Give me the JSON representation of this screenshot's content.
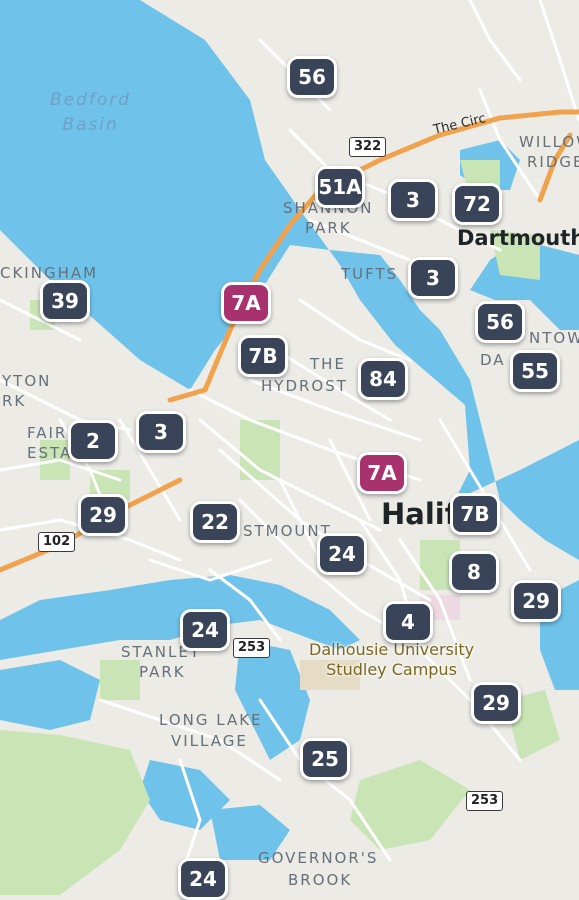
{
  "colors": {
    "land": "#ecebe6",
    "water": "#6fc3eb",
    "park": "#c9e5b5",
    "highway": "#f0a24c",
    "badge_default": "#3a4458",
    "badge_accent": "#a8326e"
  },
  "water_labels": {
    "bedford_basin": [
      "Bedford",
      "Basin"
    ]
  },
  "places": {
    "kingham": "CKINGHAM",
    "yton": "YTON",
    "rk": "RK",
    "fair": "FAIR",
    "esta": "ESTA",
    "shannon": "SHANNON",
    "park": "PARK",
    "tufts": "TUFTS",
    "the_hydrostone_1": "THE",
    "the_hydrostone_2": "HYDROST",
    "westmount": "STMOUNT",
    "stanley_1": "STANLEY",
    "stanley_2": "PARK",
    "long_lake_1": "LONG LAKE",
    "long_lake_2": "VILLAGE",
    "governors_1": "GOVERNOR'S",
    "governors_2": "BROOK",
    "willow_1": "WILLOW",
    "willow_2": "RIDGE",
    "ntown_1": "NTOW",
    "ntown_2": "DA"
  },
  "cities": {
    "dartmouth": "Dartmouth",
    "halifax": "Halif"
  },
  "poi": {
    "dalhousie_1": "Dalhousie University",
    "dalhousie_2": "Studley Campus"
  },
  "roads": {
    "the_circ": "The Circ",
    "shield_322": "322",
    "shield_102": "102",
    "shield_253_a": "253",
    "shield_253_b": "253"
  },
  "badges": [
    {
      "label": "56",
      "accent": false
    },
    {
      "label": "51A",
      "accent": false
    },
    {
      "label": "3",
      "accent": false
    },
    {
      "label": "72",
      "accent": false
    },
    {
      "label": "3",
      "accent": false
    },
    {
      "label": "39",
      "accent": false
    },
    {
      "label": "7A",
      "accent": true
    },
    {
      "label": "7B",
      "accent": false
    },
    {
      "label": "84",
      "accent": false
    },
    {
      "label": "56",
      "accent": false
    },
    {
      "label": "55",
      "accent": false
    },
    {
      "label": "2",
      "accent": false
    },
    {
      "label": "3",
      "accent": false
    },
    {
      "label": "7A",
      "accent": true
    },
    {
      "label": "29",
      "accent": false
    },
    {
      "label": "22",
      "accent": false
    },
    {
      "label": "7B",
      "accent": false
    },
    {
      "label": "24",
      "accent": false
    },
    {
      "label": "8",
      "accent": false
    },
    {
      "label": "29",
      "accent": false
    },
    {
      "label": "4",
      "accent": false
    },
    {
      "label": "24",
      "accent": false
    },
    {
      "label": "29",
      "accent": false
    },
    {
      "label": "25",
      "accent": false
    },
    {
      "label": "24",
      "accent": false
    }
  ]
}
